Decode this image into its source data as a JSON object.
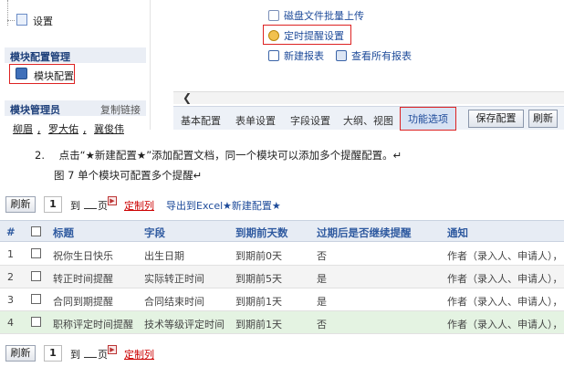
{
  "left_panel": {
    "settings_label": "设置",
    "module_section_title": "模块配置管理",
    "module_config_label": "模块配置",
    "admin_section_title": "模块管理员",
    "copy_link_label": "复制链接",
    "admins": [
      "柳眉",
      "罗大佑",
      "冀俊伟"
    ]
  },
  "right_panel": {
    "batch_upload_label": "磁盘文件批量上传",
    "timer_setting_label": "定时提醒设置",
    "new_report_label": "新建报表",
    "view_reports_label": "查看所有报表",
    "tabs": [
      "基本配置",
      "表单设置",
      "字段设置",
      "大纲、视图",
      "功能选项"
    ],
    "save_config_label": "保存配置",
    "refresh_label": "刷新"
  },
  "caption": {
    "step": "2.",
    "instruction": "点击“★新建配置★”添加配置文档，同一个模块可以添加多个提醒配置。↵",
    "figure": "图 7 单个模块可配置多个提醒↵"
  },
  "toolbar": {
    "refresh_label": "刷新",
    "page_number": "1",
    "to_label": "到",
    "page_label": "页",
    "custom_columns_label": "定制列",
    "export_excel_label": "导出到Excel",
    "new_config_label": "★新建配置★"
  },
  "table": {
    "headers": [
      "#",
      "标题",
      "字段",
      "到期前天数",
      "过期后是否继续提醒",
      "通知"
    ],
    "rows": [
      {
        "num": "1",
        "title": "祝你生日快乐",
        "field": "出生日期",
        "days": "到期前0天",
        "continue": "否",
        "notify": "作者（录入人、申请人），"
      },
      {
        "num": "2",
        "title": "转正时间提醒",
        "field": "实际转正时间",
        "days": "到期前5天",
        "continue": "是",
        "notify": "作者（录入人、申请人），"
      },
      {
        "num": "3",
        "title": "合同到期提醒",
        "field": "合同结束时间",
        "days": "到期前1天",
        "continue": "是",
        "notify": "作者（录入人、申请人），"
      },
      {
        "num": "4",
        "title": "职称评定时间提醒",
        "field": "技术等级评定时间",
        "days": "到期前1天",
        "continue": "否",
        "notify": "作者（录入人、申请人），"
      }
    ]
  },
  "bottom_toolbar": {
    "refresh_label": "刷新",
    "page_number": "1",
    "to_label": "到",
    "page_label": "页",
    "custom_columns_label": "定制列"
  }
}
